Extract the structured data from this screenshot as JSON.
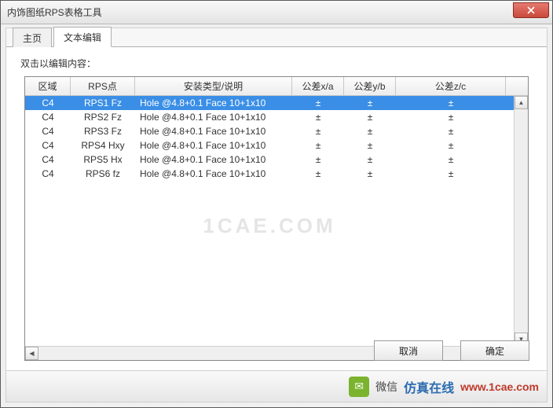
{
  "window": {
    "title": "内饰图纸RPS表格工具"
  },
  "tabs": [
    {
      "label": "主页",
      "active": false
    },
    {
      "label": "文本编辑",
      "active": true
    }
  ],
  "instruction": "双击以编辑内容：",
  "columns": [
    "区域",
    "RPS点",
    "安装类型/说明",
    "公差x/a",
    "公差y/b",
    "公差z/c"
  ],
  "rows": [
    {
      "region": "C4",
      "rps": "RPS1 Fz",
      "desc": "Hole @4.8+0.1 Face 10+1x10",
      "tx": "±",
      "ty": "±",
      "tz": "±",
      "selected": true
    },
    {
      "region": "C4",
      "rps": "RPS2 Fz",
      "desc": "Hole @4.8+0.1 Face 10+1x10",
      "tx": "±",
      "ty": "±",
      "tz": "±",
      "selected": false
    },
    {
      "region": "C4",
      "rps": "RPS3 Fz",
      "desc": "Hole @4.8+0.1 Face 10+1x10",
      "tx": "±",
      "ty": "±",
      "tz": "±",
      "selected": false
    },
    {
      "region": "C4",
      "rps": "RPS4 Hxy",
      "desc": "Hole @4.8+0.1 Face 10+1x10",
      "tx": "±",
      "ty": "±",
      "tz": "±",
      "selected": false
    },
    {
      "region": "C4",
      "rps": "RPS5 Hx",
      "desc": "Hole @4.8+0.1 Face 10+1x10",
      "tx": "±",
      "ty": "±",
      "tz": "±",
      "selected": false
    },
    {
      "region": "C4",
      "rps": "RPS6 fz",
      "desc": "Hole @4.8+0.1 Face 10+1x10",
      "tx": "±",
      "ty": "±",
      "tz": "±",
      "selected": false
    }
  ],
  "watermark": "1CAE.COM",
  "buttons": {
    "cancel": "取消",
    "ok": "确定"
  },
  "footer": {
    "wx": "微信",
    "brand": "仿真在线",
    "url": "www.1cae.com"
  }
}
